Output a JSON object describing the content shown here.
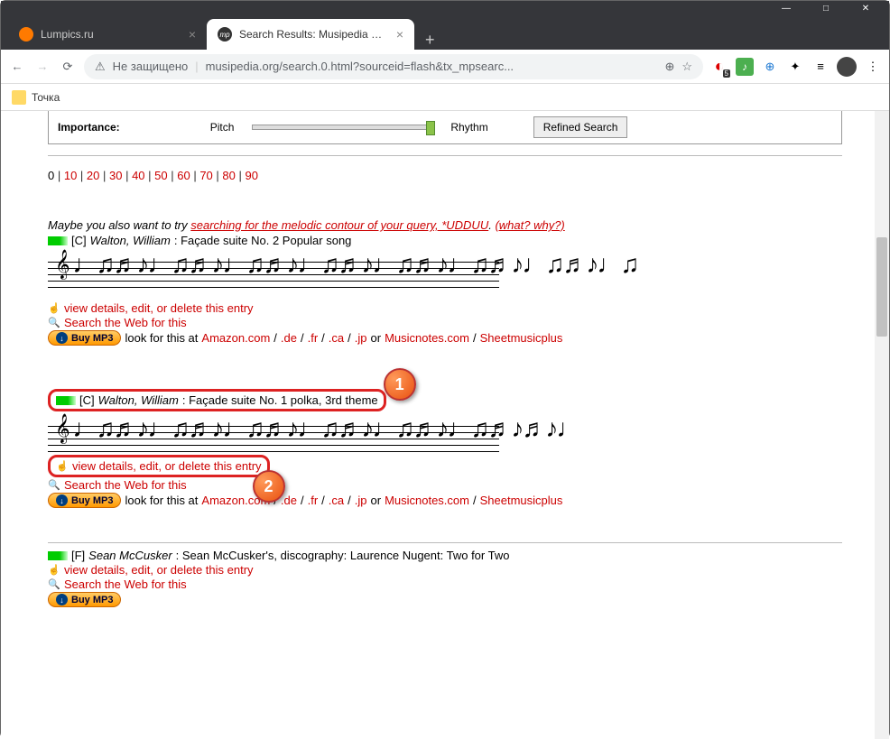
{
  "window": {
    "tabs": [
      {
        "title": "Lumpics.ru",
        "favicon_color": "#ff7a00"
      },
      {
        "title": "Search Results: Musipedia Meloc",
        "favicon_text": "mp"
      }
    ],
    "address": {
      "warning": "Не защищено",
      "url": "musipedia.org/search.0.html?sourceid=flash&tx_mpsearc..."
    },
    "bookmark": "Точка"
  },
  "controls": {
    "importance": "Importance:",
    "pitch": "Pitch",
    "rhythm": "Rhythm",
    "refined": "Refined Search"
  },
  "pager": [
    "0",
    "10",
    "20",
    "30",
    "40",
    "50",
    "60",
    "70",
    "80",
    "90"
  ],
  "hint": {
    "prefix": "Maybe you also want to try ",
    "link": "searching for the melodic contour of your query, *UDDUU",
    "suffix": ". ",
    "what": "(what? why?)"
  },
  "results": [
    {
      "key": "[C]",
      "composer": "Walton, William",
      "title": ": Façade suite No. 2 Popular song",
      "view": "view details, edit, or delete this entry",
      "search": "Search the Web for this",
      "buy": "Buy MP3",
      "lookfor": " look for this at ",
      "amazon": "Amazon.com",
      "domains": [
        ".de",
        ".fr",
        ".ca",
        ".jp"
      ],
      "or": " or ",
      "musicnotes": "Musicnotes.com",
      "smp": "Sheetmusicplus"
    },
    {
      "key": "[C]",
      "composer": "Walton, William",
      "title": ": Façade suite No. 1 polka, 3rd theme",
      "view": "view details, edit, or delete this entry",
      "search": "Search the Web for this",
      "buy": "Buy MP3",
      "lookfor": " look for this at ",
      "amazon": "Amazon.com",
      "domains": [
        ".de",
        ".fr",
        ".ca",
        ".jp"
      ],
      "or": " or ",
      "musicnotes": "Musicnotes.com",
      "smp": "Sheetmusicplus"
    },
    {
      "key": "[F]",
      "composer": "Sean McCusker",
      "title": ": Sean McCusker's, discography: Laurence Nugent: Two for Two",
      "view": "view details, edit, or delete this entry",
      "search": "Search the Web for this",
      "buy": "Buy MP3"
    }
  ],
  "annotation": {
    "b1": "1",
    "b2": "2"
  }
}
